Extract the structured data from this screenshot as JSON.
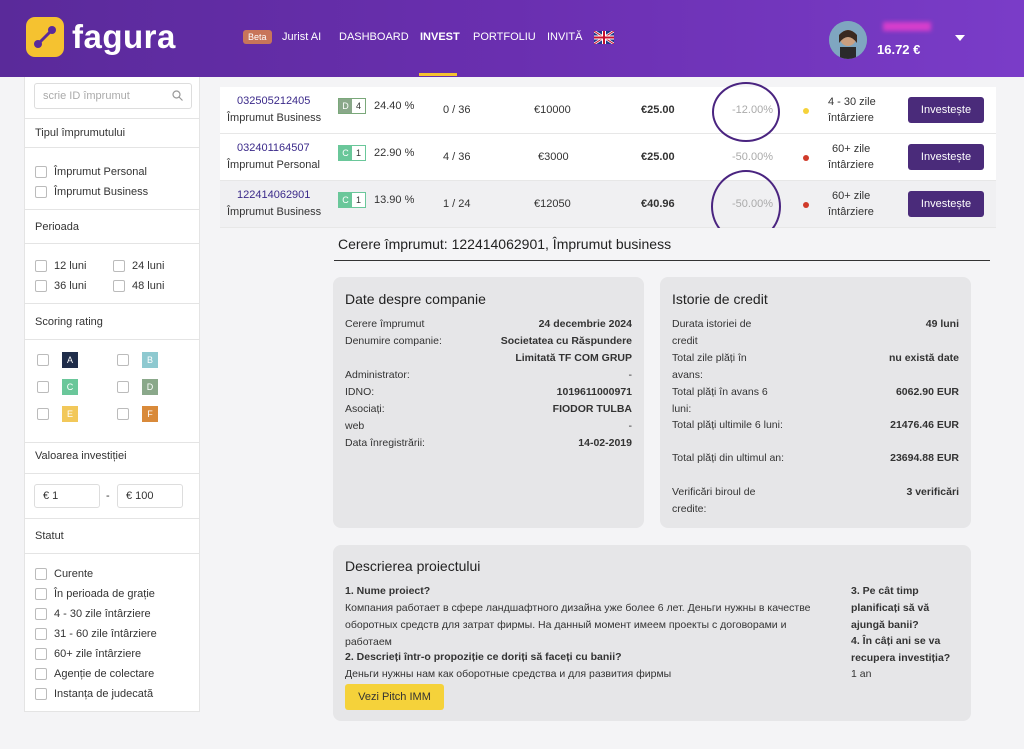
{
  "header": {
    "brand": "fagura",
    "beta": "Beta",
    "nav": [
      "Jurist AI",
      "DASHBOARD",
      "INVEST",
      "PORTFOLIU",
      "INVITĂ"
    ],
    "balance": "16.72 €"
  },
  "sidebar": {
    "search_placeholder": "scrie ID împrumut",
    "loan_type_title": "Tipul împrumutului",
    "loan_types": [
      "Împrumut Personal",
      "Împrumut Business"
    ],
    "period_title": "Perioada",
    "periods": [
      "12 luni",
      "24 luni",
      "36 luni",
      "48 luni"
    ],
    "scoring_title": "Scoring rating",
    "grades": [
      {
        "letter": "A",
        "color": "#1f2d4a"
      },
      {
        "letter": "B",
        "color": "#8ec9d0"
      },
      {
        "letter": "C",
        "color": "#6ac79a"
      },
      {
        "letter": "D",
        "color": "#8aa88a"
      },
      {
        "letter": "E",
        "color": "#f2c85a"
      },
      {
        "letter": "F",
        "color": "#d98a3a"
      }
    ],
    "investment_title": "Valoarea investiției",
    "inv_min": "€ 1",
    "inv_dash": "-",
    "inv_max": "€ 100",
    "status_title": "Statut",
    "statuses": [
      "Curente",
      "În perioada de grație",
      "4 - 30 zile întârziere",
      "31 - 60 zile întârziere",
      "60+ zile întârziere",
      "Agenție de colectare",
      "Instanța de judecată"
    ]
  },
  "loans": [
    {
      "id": "032505212405",
      "type": "Împrumut Business",
      "grade": "D",
      "grade_color": "#8aa88a",
      "score": "4",
      "rate": "24.40 %",
      "terms": "0 / 36",
      "amount": "€10000",
      "price": "€25.00",
      "discount": "-12.00%",
      "status_color": "#f5d23a",
      "status_l1": "4 - 30 zile",
      "status_l2": "întârziere",
      "button": "Investește"
    },
    {
      "id": "032401164507",
      "type": "Împrumut Personal",
      "grade": "C",
      "grade_color": "#6ac79a",
      "score": "1",
      "rate": "22.90 %",
      "terms": "4 / 36",
      "amount": "€3000",
      "price": "€25.00",
      "discount": "-50.00%",
      "status_color": "#d03a2a",
      "status_l1": "60+ zile",
      "status_l2": "întârziere",
      "button": "Investește"
    },
    {
      "id": "122414062901",
      "type": "Împrumut Business",
      "grade": "C",
      "grade_color": "#6ac79a",
      "score": "1",
      "rate": "13.90 %",
      "terms": "1 / 24",
      "amount": "€12050",
      "price": "€40.96",
      "discount": "-50.00%",
      "status_color": "#d03a2a",
      "status_l1": "60+ zile",
      "status_l2": "întârziere",
      "button": "Investește"
    }
  ],
  "detail": {
    "title": "Cerere împrumut: 122414062901, Împrumut business",
    "company_title": "Date despre companie",
    "company": [
      {
        "k": "Cerere împrumut",
        "v": "24 decembrie 2024"
      },
      {
        "k": "Denumire companie:",
        "v": "Societatea cu Răspundere Limitată TF COM GRUP"
      },
      {
        "k": "Administrator:",
        "v": "-"
      },
      {
        "k": "IDNO:",
        "v": "1019611000971"
      },
      {
        "k": "Asociați:",
        "v": "FIODOR TULBA"
      },
      {
        "k": "web",
        "v": "-"
      },
      {
        "k": "Data înregistrării:",
        "v": "14-02-2019"
      }
    ],
    "credit_title": "Istorie de credit",
    "credit": [
      {
        "k": "Durata istoriei de credit",
        "v": "49 luni"
      },
      {
        "k": "Total zile plăți în avans:",
        "v": "nu există date"
      },
      {
        "k": "Total plăți în avans 6 luni:",
        "v": "6062.90 EUR"
      },
      {
        "k": "Total plăți ultimile 6 luni:",
        "v": "21476.46 EUR"
      },
      {
        "k": "Total plăți din ultimul an:",
        "v": "23694.88 EUR"
      },
      {
        "k": "Verificări biroul de credite:",
        "v": "3 verificări"
      }
    ],
    "project_title": "Descrierea proiectului",
    "q1": "1. Nume proiect?",
    "a1": "Компания работает в сфере ландшафтного дизайна уже более 6 лет. Деньги нужны в качестве оборотных средств для затрат фирмы. На данный момент имеем проекты с договорами и работаем",
    "q2": "2. Descrieți într-o propoziție ce doriți să faceți cu banii?",
    "a2": "Деньги нужны нам как оборотные средства и для развития фирмы",
    "q3": "3. Pe cât timp planificați să vă ajungă banii?",
    "q4": "4. În câți ani se va recupera investiția?",
    "a4": "1 an",
    "pitch": "Vezi Pitch IMM"
  }
}
